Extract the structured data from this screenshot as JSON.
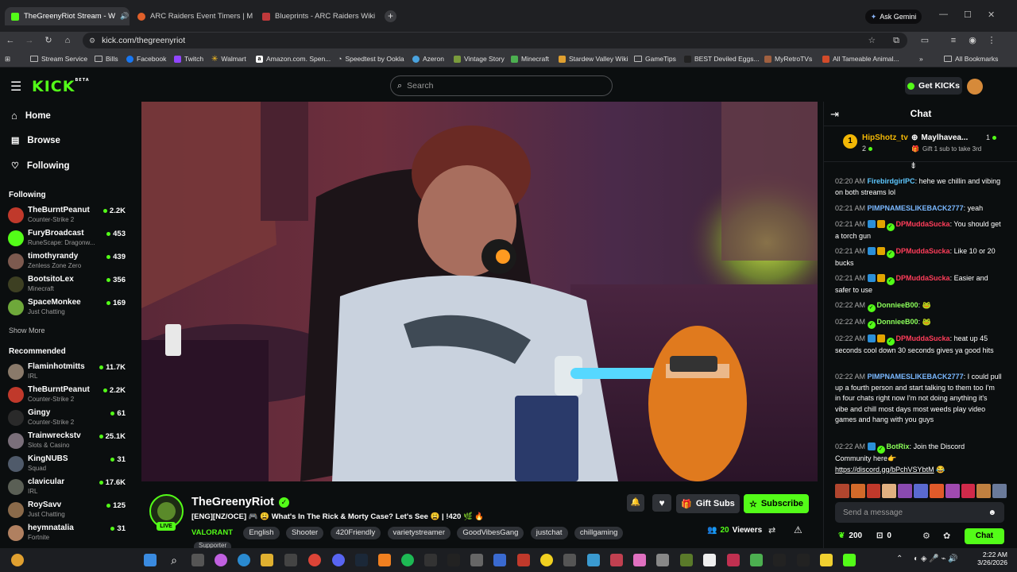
{
  "browser": {
    "tabs": [
      {
        "label": "TheGreenyRiot Stream - W",
        "active": true
      },
      {
        "label": "ARC Raiders Event Timers | Me",
        "active": false
      },
      {
        "label": "Blueprints - ARC Raiders Wiki",
        "active": false
      }
    ],
    "gemini_label": "Ask Gemini",
    "url": "kick.com/thegreenyriot",
    "bookmarks": [
      "Stream Service",
      "Bills",
      "Facebook",
      "Twitch",
      "Walmart",
      "Amazon.com. Spen...",
      "Speedtest by Ookla",
      "Azeron",
      "Vintage Story",
      "Minecraft",
      "Stardew Valley Wiki",
      "GameTips",
      "BEST Deviled Eggs...",
      "MyRetroTVs",
      "All Tameable Animal..."
    ],
    "all_bookmarks": "All Bookmarks"
  },
  "header": {
    "search_placeholder": "Search",
    "get_kicks": "Get KICKs"
  },
  "sidebar": {
    "nav": [
      {
        "label": "Home"
      },
      {
        "label": "Browse"
      },
      {
        "label": "Following"
      }
    ],
    "following_title": "Following",
    "following": [
      {
        "name": "TheBurntPeanut",
        "category": "Counter-Strike 2",
        "viewers": "2.2K"
      },
      {
        "name": "FuryBroadcast",
        "category": "RuneScape: Dragonw...",
        "viewers": "453"
      },
      {
        "name": "timothyrandy",
        "category": "Zenless Zone Zero",
        "viewers": "439"
      },
      {
        "name": "BootsitoLex",
        "category": "Minecraft",
        "viewers": "356"
      },
      {
        "name": "SpaceMonkee",
        "category": "Just Chatting",
        "viewers": "169"
      }
    ],
    "show_more": "Show More",
    "recommended_title": "Recommended",
    "recommended": [
      {
        "name": "Flaminhotmitts",
        "category": "IRL",
        "viewers": "11.7K"
      },
      {
        "name": "TheBurntPeanut",
        "category": "Counter-Strike 2",
        "viewers": "2.2K"
      },
      {
        "name": "Gingy",
        "category": "Counter-Strike 2",
        "viewers": "61"
      },
      {
        "name": "Trainwreckstv",
        "category": "Slots & Casino",
        "viewers": "25.1K"
      },
      {
        "name": "KingNUBS",
        "category": "Squad",
        "viewers": "31"
      },
      {
        "name": "clavicular",
        "category": "IRL",
        "viewers": "17.6K"
      },
      {
        "name": "RoySavv",
        "category": "Just Chatting",
        "viewers": "125"
      },
      {
        "name": "heymnatalia",
        "category": "Fortnite",
        "viewers": "31"
      }
    ]
  },
  "stream": {
    "channel": "TheGreenyRiot",
    "live_label": "LIVE",
    "title": "[ENG][NZ/OCE] 🎮 😩 What's In The Rick & Morty Case? Let's See 😩 | !420 🌿 🔥",
    "category": "VALORANT",
    "tags": [
      "English",
      "Shooter",
      "420Friendly",
      "varietystreamer",
      "GoodVibesGang",
      "justchat",
      "chillgaming"
    ],
    "extra_tag": "Supporter",
    "viewers": "20",
    "viewers_label": "Viewers",
    "gift_subs": "Gift Subs",
    "subscribe": "Subscribe"
  },
  "chat": {
    "title": "Chat",
    "pinned": {
      "rank": "1",
      "user1": "HipShotz_tv",
      "user1_count": "2",
      "user2": "Maylhavea...",
      "user2_count": "1",
      "gift_text": "Gift 1 sub to take 3rd"
    },
    "messages": [
      {
        "time": "02:20 AM",
        "user": "FirebirdgirlPC",
        "color": "#5ec8ff",
        "text": "hehe we chillin and vibing on both streams lol"
      },
      {
        "time": "02:21 AM",
        "user": "PIMPNAMESLIKEBACK2777",
        "color": "#7ab8ff",
        "text": "yeah"
      },
      {
        "time": "02:21 AM",
        "user": "DPMuddaSucka",
        "color": "#ff3d5a",
        "text": "You should get a torch gun"
      },
      {
        "time": "02:21 AM",
        "user": "DPMuddaSucka",
        "color": "#ff3d5a",
        "text": "Like 10 or 20 bucks"
      },
      {
        "time": "02:21 AM",
        "user": "DPMuddaSucka",
        "color": "#ff3d5a",
        "text": "Easier and safer to use"
      },
      {
        "time": "02:22 AM",
        "user": "DonnieeB00",
        "color": "#8cff5a",
        "text": "🐸"
      },
      {
        "time": "02:22 AM",
        "user": "DonnieeB00",
        "color": "#8cff5a",
        "text": "🐸"
      },
      {
        "time": "02:22 AM",
        "user": "DPMuddaSucka",
        "color": "#ff3d5a",
        "text": "heat up 45 seconds cool down 30 seconds gives ya good hits"
      },
      {
        "time": "02:22 AM",
        "user": "PIMPNAMESLIKEBACK2777",
        "color": "#7ab8ff",
        "text": "I could pull up a fourth person and start talking to them too I'm in four chats right now I'm not doing anything it's vibe and chill most days most weeds play video games and hang with you guys"
      },
      {
        "time": "02:22 AM",
        "user": "BotRix",
        "color": "#8cff5a",
        "text": "Join the Discord Community here👉"
      }
    ],
    "link": "https://discord.gg/bPchVSYbtM",
    "input_placeholder": "Send a message",
    "points": "200",
    "gifts": "0",
    "send_label": "Chat"
  },
  "taskbar": {
    "time": "2:22 AM",
    "date": "3/26/2026"
  }
}
